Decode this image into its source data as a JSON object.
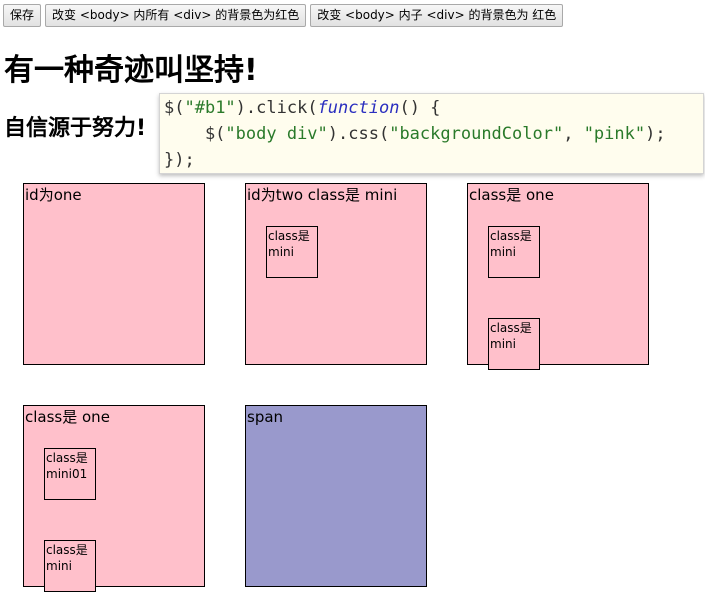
{
  "toolbar": {
    "save_label": "保存",
    "btn_all_label": "改变 <body> 内所有 <div> 的背景色为红色",
    "btn_child_label": "改变 <body> 内子 <div> 的背景色为 红色"
  },
  "heading1": "有一种奇迹叫坚持!",
  "heading2": "自信源于努力!",
  "code": {
    "line1_a": "$(",
    "line1_b": "\"#b1\"",
    "line1_c": ").click(",
    "line1_d": "function",
    "line1_e": "() {",
    "line2_a": "    $(",
    "line2_b": "\"body div\"",
    "line2_c": ").css(",
    "line2_d": "\"backgroundColor\"",
    "line2_e": ", ",
    "line2_f": "\"pink\"",
    "line2_g": ");",
    "line3": "});"
  },
  "boxes": {
    "one": {
      "title": "id为one"
    },
    "two": {
      "title": "id为two class是 mini",
      "mini1": "class是\nmini"
    },
    "three": {
      "title": "class是 one",
      "mini1": "class是\nmini",
      "mini2": "class是\nmini"
    },
    "four": {
      "title": "class是 one",
      "mini1": "class是\nmini01",
      "mini2": "class是\nmini"
    },
    "span": {
      "title": "span"
    }
  },
  "colors": {
    "box_bg": "#ffc0cb",
    "span_bg": "#9999cc",
    "code_bg": "#fffdee"
  }
}
